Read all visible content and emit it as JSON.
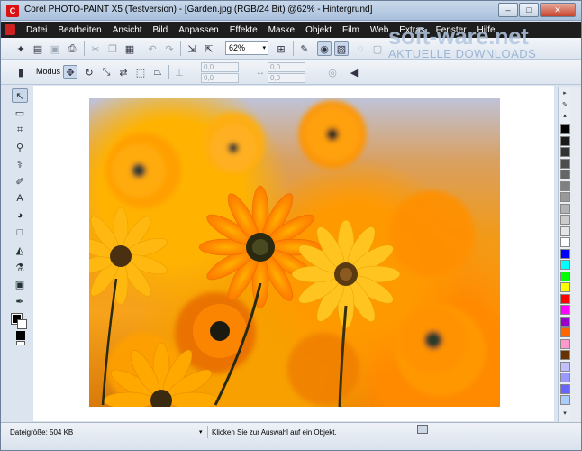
{
  "window": {
    "app_icon_glyph": "C",
    "title": "Corel PHOTO-PAINT X5 (Testversion) - [Garden.jpg (RGB/24 Bit) @62% - Hintergrund]",
    "buttons": {
      "minimize": "–",
      "maximize": "□",
      "close": "✕"
    }
  },
  "menu": {
    "items": [
      "Datei",
      "Bearbeiten",
      "Ansicht",
      "Bild",
      "Anpassen",
      "Effekte",
      "Maske",
      "Objekt",
      "Film",
      "Web",
      "Extras",
      "Fenster",
      "Hilfe"
    ]
  },
  "toolbar": {
    "zoom": "62%",
    "zoom_arrow": "▾"
  },
  "property_bar": {
    "modus_label": "Modus",
    "fields": [
      "0,0",
      "0,0",
      "0,0",
      "0,0"
    ]
  },
  "watermark": {
    "main": "soft-ware.net",
    "sub": "AKTUELLE DOWNLOADS"
  },
  "palette": {
    "colors": [
      "#000000",
      "#1a1a1a",
      "#333333",
      "#4d4d4d",
      "#666666",
      "#808080",
      "#999999",
      "#b3b3b3",
      "#cccccc",
      "#e6e6e6",
      "#ffffff",
      "#0000ff",
      "#00ffff",
      "#00ff00",
      "#ffff00",
      "#ff0000",
      "#ff00ff",
      "#9900cc",
      "#ff6600",
      "#ff99cc",
      "#663300",
      "#c0c0ff",
      "#9999ff",
      "#6666ff",
      "#aaccff"
    ]
  },
  "status": {
    "file_size": "Dateigröße: 504 KB",
    "dropdown": "▾",
    "hint": "Klicken Sie zur Auswahl auf ein Objekt."
  },
  "colors": {
    "menu_bg": "#1e1e1e",
    "accent_red": "#cc2222"
  }
}
